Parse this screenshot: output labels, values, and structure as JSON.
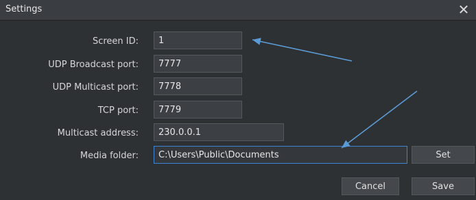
{
  "window": {
    "title": "Settings",
    "close_glyph": "✕"
  },
  "fields": {
    "screen_id": {
      "label": "Screen ID:",
      "value": "1"
    },
    "udp_broadcast_port": {
      "label": "UDP Broadcast port:",
      "value": "7777"
    },
    "udp_multicast_port": {
      "label": "UDP Multicast port:",
      "value": "7778"
    },
    "tcp_port": {
      "label": "TCP port:",
      "value": "7779"
    },
    "multicast_address": {
      "label": "Multicast address:",
      "value": "230.0.0.1"
    },
    "media_folder": {
      "label": "Media folder:",
      "value": "C:\\Users\\Public\\Documents"
    }
  },
  "buttons": {
    "set": "Set",
    "cancel": "Cancel",
    "save": "Save"
  },
  "annotations": {
    "arrow_color": "#5b9bd5"
  },
  "icons": {
    "close": "close-icon",
    "arrows": "annotation-arrow"
  }
}
